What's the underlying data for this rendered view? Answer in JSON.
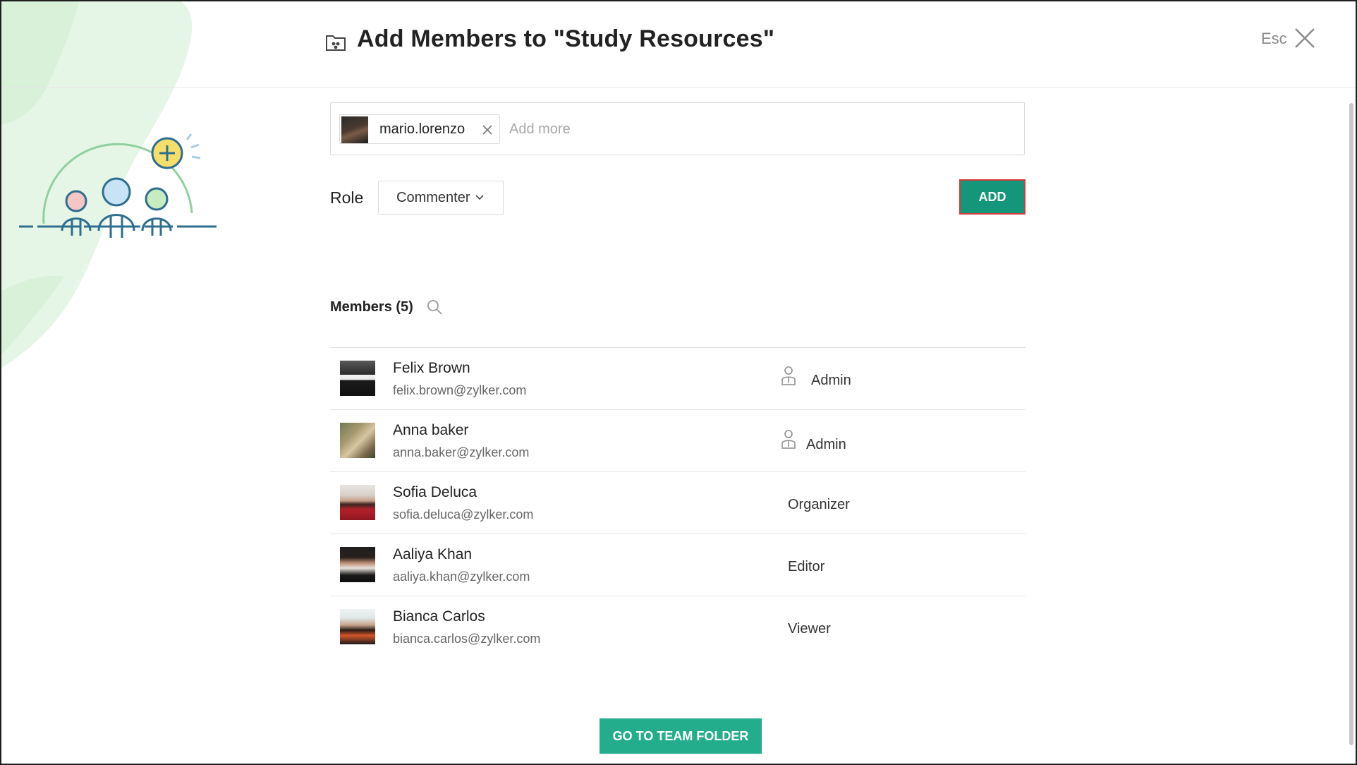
{
  "header": {
    "folder_icon": "team-folder-icon",
    "title": "Add Members to \"Study Resources\"",
    "esc_label": "Esc",
    "close_icon": "close-icon"
  },
  "recipients": {
    "chips": [
      {
        "label": "mario.lorenzo",
        "avatar": "avatar-photo",
        "remove_icon": "close-icon"
      }
    ],
    "placeholder": "Add more"
  },
  "role": {
    "label": "Role",
    "selected": "Commenter",
    "chevron_icon": "chevron-down-icon"
  },
  "add_button_label": "ADD",
  "members": {
    "header": "Members (5)",
    "search_icon": "search-icon",
    "items": [
      {
        "name": "Felix Brown",
        "email": "felix.brown@zylker.com",
        "role": "Admin",
        "role_icon": "admin-user-icon"
      },
      {
        "name": "Anna baker",
        "email": "anna.baker@zylker.com",
        "role": "Admin",
        "role_icon": "admin-user-icon"
      },
      {
        "name": "Sofia Deluca",
        "email": "sofia.deluca@zylker.com",
        "role": "Organizer"
      },
      {
        "name": "Aaliya Khan",
        "email": "aaliya.khan@zylker.com",
        "role": "Editor"
      },
      {
        "name": "Bianca Carlos",
        "email": "bianca.carlos@zylker.com",
        "role": "Viewer"
      }
    ]
  },
  "go_button_label": "GO TO TEAM FOLDER",
  "colors": {
    "accent": "#14967a",
    "accent_light": "#23ad8c",
    "focus_border": "#d9393b",
    "blob": "#e3f4e3"
  }
}
